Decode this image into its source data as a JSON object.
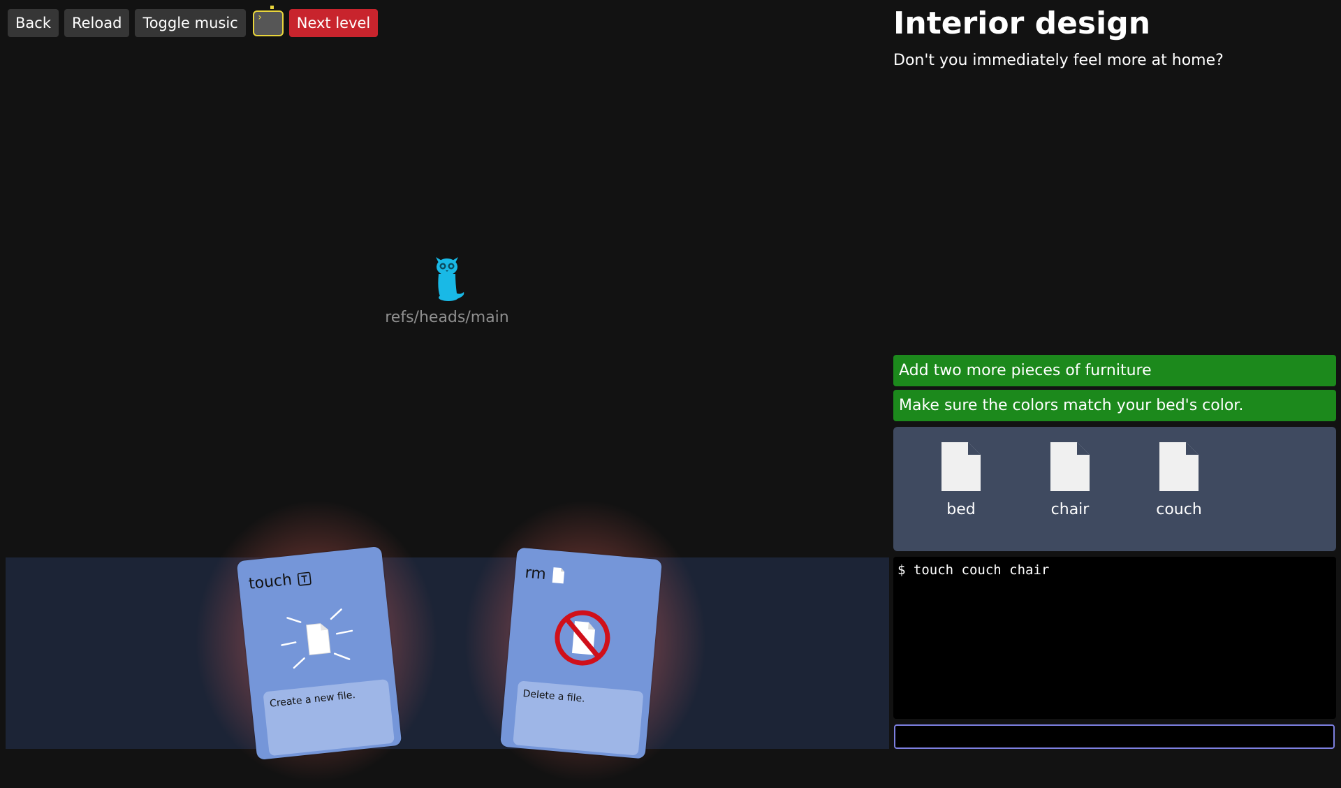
{
  "toolbar": {
    "back_label": "Back",
    "reload_label": "Reload",
    "toggle_music_label": "Toggle music",
    "terminal_icon": "terminal-icon",
    "next_level_label": "Next level"
  },
  "graph": {
    "ref_label": "refs/heads/main",
    "ref_icon": "octocat-ref-icon",
    "ref_color": "#19b9e6"
  },
  "cards": [
    {
      "command": "touch",
      "description": "Create a new file.",
      "icon": "file-burst-icon"
    },
    {
      "command": "rm",
      "description": "Delete a file.",
      "icon": "file-prohibited-icon"
    }
  ],
  "level": {
    "title": "Interior design",
    "description": "Don't you immediately feel more at home?"
  },
  "goals": [
    {
      "text": "Add two more pieces of furniture",
      "status_color": "#1c891c"
    },
    {
      "text": "Make sure the colors match your bed's color.",
      "status_color": "#1c891c"
    }
  ],
  "files": [
    {
      "name": "bed",
      "icon": "file-icon"
    },
    {
      "name": "chair",
      "icon": "file-icon"
    },
    {
      "name": "couch",
      "icon": "file-icon"
    }
  ],
  "terminal": {
    "history": "$ touch couch chair",
    "input_value": ""
  }
}
